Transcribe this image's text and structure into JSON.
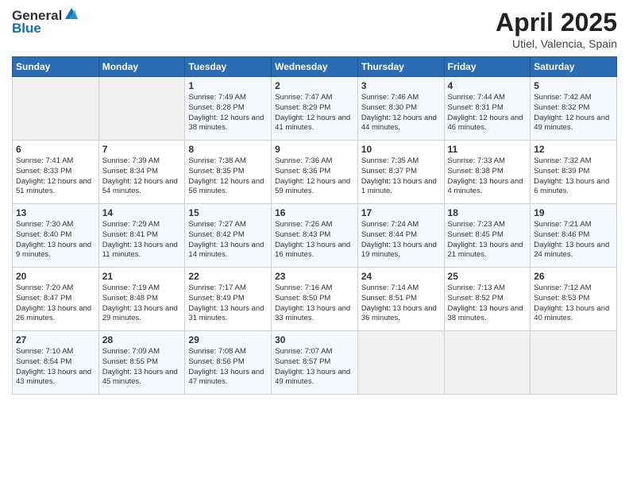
{
  "header": {
    "logo_line1": "General",
    "logo_line2": "Blue",
    "title": "April 2025",
    "location": "Utiel, Valencia, Spain"
  },
  "weekdays": [
    "Sunday",
    "Monday",
    "Tuesday",
    "Wednesday",
    "Thursday",
    "Friday",
    "Saturday"
  ],
  "weeks": [
    [
      {
        "day": "",
        "info": ""
      },
      {
        "day": "",
        "info": ""
      },
      {
        "day": "1",
        "info": "Sunrise: 7:49 AM\nSunset: 8:28 PM\nDaylight: 12 hours and 38 minutes."
      },
      {
        "day": "2",
        "info": "Sunrise: 7:47 AM\nSunset: 8:29 PM\nDaylight: 12 hours and 41 minutes."
      },
      {
        "day": "3",
        "info": "Sunrise: 7:46 AM\nSunset: 8:30 PM\nDaylight: 12 hours and 44 minutes."
      },
      {
        "day": "4",
        "info": "Sunrise: 7:44 AM\nSunset: 8:31 PM\nDaylight: 12 hours and 46 minutes."
      },
      {
        "day": "5",
        "info": "Sunrise: 7:42 AM\nSunset: 8:32 PM\nDaylight: 12 hours and 49 minutes."
      }
    ],
    [
      {
        "day": "6",
        "info": "Sunrise: 7:41 AM\nSunset: 8:33 PM\nDaylight: 12 hours and 51 minutes."
      },
      {
        "day": "7",
        "info": "Sunrise: 7:39 AM\nSunset: 8:34 PM\nDaylight: 12 hours and 54 minutes."
      },
      {
        "day": "8",
        "info": "Sunrise: 7:38 AM\nSunset: 8:35 PM\nDaylight: 12 hours and 56 minutes."
      },
      {
        "day": "9",
        "info": "Sunrise: 7:36 AM\nSunset: 8:36 PM\nDaylight: 12 hours and 59 minutes."
      },
      {
        "day": "10",
        "info": "Sunrise: 7:35 AM\nSunset: 8:37 PM\nDaylight: 13 hours and 1 minute."
      },
      {
        "day": "11",
        "info": "Sunrise: 7:33 AM\nSunset: 8:38 PM\nDaylight: 13 hours and 4 minutes."
      },
      {
        "day": "12",
        "info": "Sunrise: 7:32 AM\nSunset: 8:39 PM\nDaylight: 13 hours and 6 minutes."
      }
    ],
    [
      {
        "day": "13",
        "info": "Sunrise: 7:30 AM\nSunset: 8:40 PM\nDaylight: 13 hours and 9 minutes."
      },
      {
        "day": "14",
        "info": "Sunrise: 7:29 AM\nSunset: 8:41 PM\nDaylight: 13 hours and 11 minutes."
      },
      {
        "day": "15",
        "info": "Sunrise: 7:27 AM\nSunset: 8:42 PM\nDaylight: 13 hours and 14 minutes."
      },
      {
        "day": "16",
        "info": "Sunrise: 7:26 AM\nSunset: 8:43 PM\nDaylight: 13 hours and 16 minutes."
      },
      {
        "day": "17",
        "info": "Sunrise: 7:24 AM\nSunset: 8:44 PM\nDaylight: 13 hours and 19 minutes."
      },
      {
        "day": "18",
        "info": "Sunrise: 7:23 AM\nSunset: 8:45 PM\nDaylight: 13 hours and 21 minutes."
      },
      {
        "day": "19",
        "info": "Sunrise: 7:21 AM\nSunset: 8:46 PM\nDaylight: 13 hours and 24 minutes."
      }
    ],
    [
      {
        "day": "20",
        "info": "Sunrise: 7:20 AM\nSunset: 8:47 PM\nDaylight: 13 hours and 26 minutes."
      },
      {
        "day": "21",
        "info": "Sunrise: 7:19 AM\nSunset: 8:48 PM\nDaylight: 13 hours and 29 minutes."
      },
      {
        "day": "22",
        "info": "Sunrise: 7:17 AM\nSunset: 8:49 PM\nDaylight: 13 hours and 31 minutes."
      },
      {
        "day": "23",
        "info": "Sunrise: 7:16 AM\nSunset: 8:50 PM\nDaylight: 13 hours and 33 minutes."
      },
      {
        "day": "24",
        "info": "Sunrise: 7:14 AM\nSunset: 8:51 PM\nDaylight: 13 hours and 36 minutes."
      },
      {
        "day": "25",
        "info": "Sunrise: 7:13 AM\nSunset: 8:52 PM\nDaylight: 13 hours and 38 minutes."
      },
      {
        "day": "26",
        "info": "Sunrise: 7:12 AM\nSunset: 8:53 PM\nDaylight: 13 hours and 40 minutes."
      }
    ],
    [
      {
        "day": "27",
        "info": "Sunrise: 7:10 AM\nSunset: 8:54 PM\nDaylight: 13 hours and 43 minutes."
      },
      {
        "day": "28",
        "info": "Sunrise: 7:09 AM\nSunset: 8:55 PM\nDaylight: 13 hours and 45 minutes."
      },
      {
        "day": "29",
        "info": "Sunrise: 7:08 AM\nSunset: 8:56 PM\nDaylight: 13 hours and 47 minutes."
      },
      {
        "day": "30",
        "info": "Sunrise: 7:07 AM\nSunset: 8:57 PM\nDaylight: 13 hours and 49 minutes."
      },
      {
        "day": "",
        "info": ""
      },
      {
        "day": "",
        "info": ""
      },
      {
        "day": "",
        "info": ""
      }
    ]
  ]
}
